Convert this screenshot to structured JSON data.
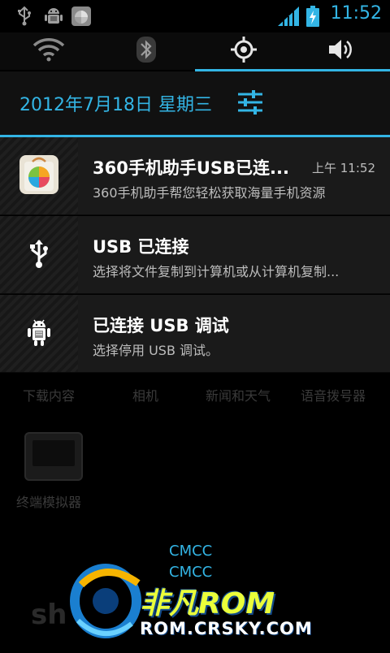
{
  "status_bar": {
    "time": "11:52",
    "icons": [
      "usb-icon",
      "android-debug-icon",
      "360-app-icon",
      "signal-icon",
      "battery-charging-icon"
    ]
  },
  "quick_settings": {
    "toggles": [
      "wifi-icon",
      "bluetooth-icon",
      "gps-icon",
      "sound-icon"
    ],
    "active_index": 2
  },
  "date_row": {
    "date": "2012年7月18日 星期三"
  },
  "notifications": [
    {
      "title": "360手机助手USB已连...",
      "subtitle": "360手机助手帮您轻松获取海量手机资源",
      "time": "上午 11:52",
      "icon": "360-app-icon"
    },
    {
      "title": "USB 已连接",
      "subtitle": "选择将文件复制到计算机或从计算机复制...",
      "icon": "usb-icon"
    },
    {
      "title": "已连接 USB 调试",
      "subtitle": "选择停用 USB 调试。",
      "icon": "android-debug-icon"
    }
  ],
  "home_apps": {
    "row_labels": [
      "下载内容",
      "相机",
      "新闻和天气",
      "语音拨号器"
    ],
    "terminal_label": "终端模拟器"
  },
  "carrier": {
    "line1": "CMCC",
    "line2": "CMCC"
  },
  "watermark": {
    "brand": "非凡ROM",
    "url": "ROM.CRSKY.COM"
  },
  "colors": {
    "accent": "#33b5e5",
    "panel": "#1a1a1a"
  }
}
